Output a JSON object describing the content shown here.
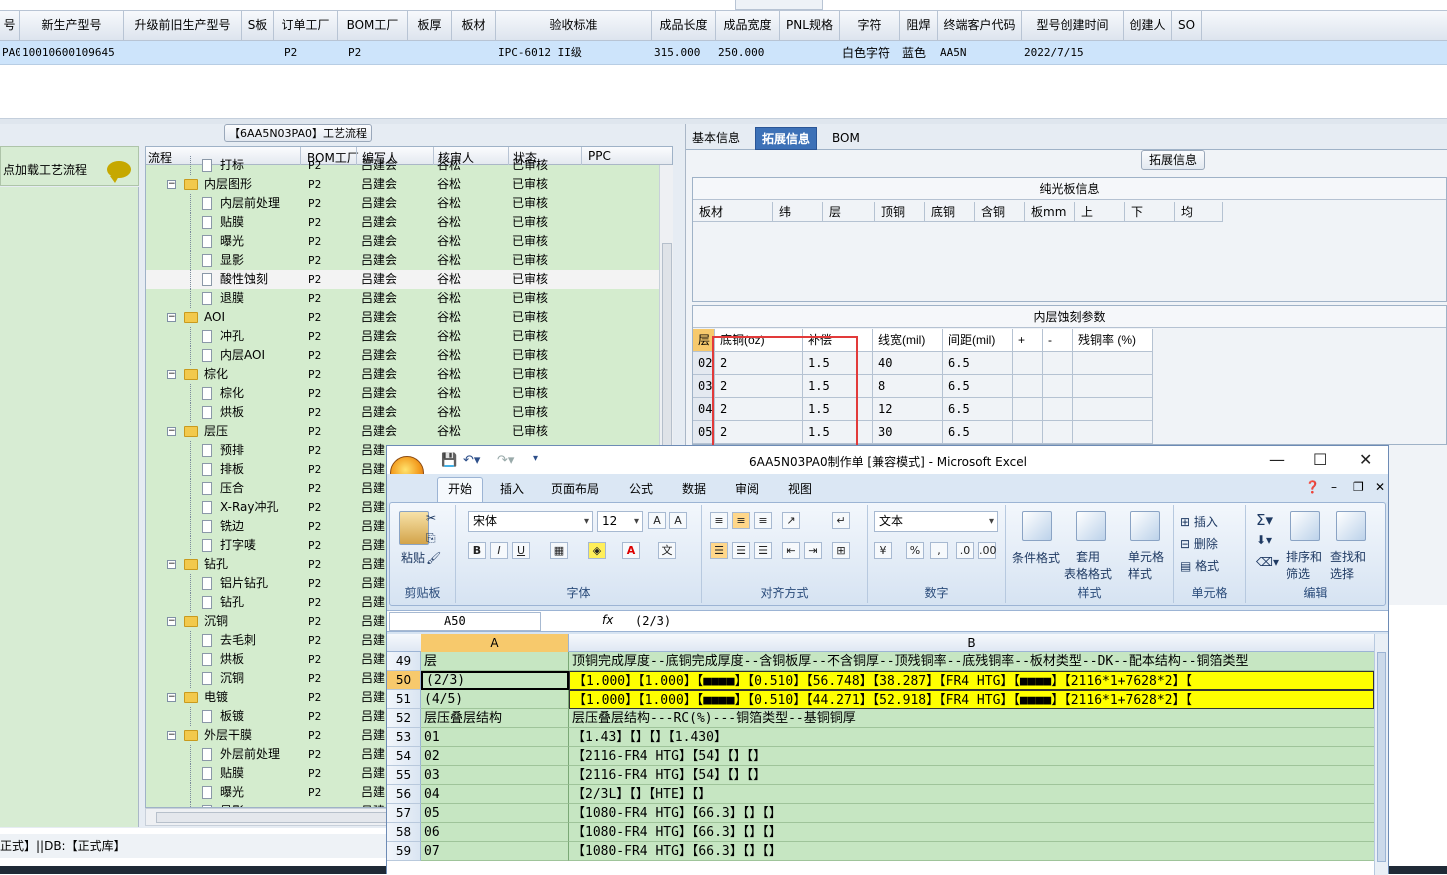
{
  "top_grid": {
    "headers": [
      "号",
      "新生产型号",
      "升级前旧生产型号",
      "S板",
      "订单工厂",
      "BOM工厂",
      "板厚",
      "板材",
      "验收标准",
      "成品长度",
      "成品宽度",
      "PNL规格",
      "字符",
      "阻焊",
      "终端客户代码",
      "型号创建时间",
      "创建人",
      "SO"
    ],
    "row": [
      "PA0",
      "10010600109645",
      "",
      "",
      "P2",
      "P2",
      "",
      "",
      "IPC-6012 II级",
      "315.000",
      "250.000",
      "",
      "白色字符",
      "蓝色",
      "AA5N",
      "2022/7/15",
      "",
      ""
    ]
  },
  "left": {
    "title": "【6AA5N03PA0】工艺流程",
    "load_label": "点加载工艺流程",
    "tree_headers": [
      "流程",
      "BOM工厂",
      "编写人",
      "核审人",
      "状态",
      "PPC"
    ],
    "rows": [
      {
        "indent": 1,
        "type": "doc",
        "name": "打标",
        "c1": "P2",
        "c2": "吕建会",
        "c3": "谷松",
        "c4": "已审核"
      },
      {
        "indent": 0,
        "type": "folder",
        "name": "内层图形",
        "c1": "P2",
        "c2": "吕建会",
        "c3": "谷松",
        "c4": "已审核"
      },
      {
        "indent": 1,
        "type": "doc",
        "name": "内层前处理",
        "c1": "P2",
        "c2": "吕建会",
        "c3": "谷松",
        "c4": "已审核"
      },
      {
        "indent": 1,
        "type": "doc",
        "name": "贴膜",
        "c1": "P2",
        "c2": "吕建会",
        "c3": "谷松",
        "c4": "已审核"
      },
      {
        "indent": 1,
        "type": "doc",
        "name": "曝光",
        "c1": "P2",
        "c2": "吕建会",
        "c3": "谷松",
        "c4": "已审核"
      },
      {
        "indent": 1,
        "type": "doc",
        "name": "显影",
        "c1": "P2",
        "c2": "吕建会",
        "c3": "谷松",
        "c4": "已审核"
      },
      {
        "indent": 1,
        "type": "doc",
        "name": "酸性蚀刻",
        "c1": "P2",
        "c2": "吕建会",
        "c3": "谷松",
        "c4": "已审核",
        "sel": true
      },
      {
        "indent": 1,
        "type": "doc",
        "name": "退膜",
        "c1": "P2",
        "c2": "吕建会",
        "c3": "谷松",
        "c4": "已审核"
      },
      {
        "indent": 0,
        "type": "folder",
        "name": "AOI",
        "c1": "P2",
        "c2": "吕建会",
        "c3": "谷松",
        "c4": "已审核"
      },
      {
        "indent": 1,
        "type": "doc",
        "name": "冲孔",
        "c1": "P2",
        "c2": "吕建会",
        "c3": "谷松",
        "c4": "已审核"
      },
      {
        "indent": 1,
        "type": "doc",
        "name": "内层AOI",
        "c1": "P2",
        "c2": "吕建会",
        "c3": "谷松",
        "c4": "已审核"
      },
      {
        "indent": 0,
        "type": "folder",
        "name": "棕化",
        "c1": "P2",
        "c2": "吕建会",
        "c3": "谷松",
        "c4": "已审核"
      },
      {
        "indent": 1,
        "type": "doc",
        "name": "棕化",
        "c1": "P2",
        "c2": "吕建会",
        "c3": "谷松",
        "c4": "已审核"
      },
      {
        "indent": 1,
        "type": "doc",
        "name": "烘板",
        "c1": "P2",
        "c2": "吕建会",
        "c3": "谷松",
        "c4": "已审核"
      },
      {
        "indent": 0,
        "type": "folder",
        "name": "层压",
        "c1": "P2",
        "c2": "吕建会",
        "c3": "谷松",
        "c4": "已审核"
      },
      {
        "indent": 1,
        "type": "doc",
        "name": "预排",
        "c1": "P2",
        "c2": "吕建",
        "c3": "",
        "c4": ""
      },
      {
        "indent": 1,
        "type": "doc",
        "name": "排板",
        "c1": "P2",
        "c2": "吕建",
        "c3": "",
        "c4": ""
      },
      {
        "indent": 1,
        "type": "doc",
        "name": "压合",
        "c1": "P2",
        "c2": "吕建",
        "c3": "",
        "c4": ""
      },
      {
        "indent": 1,
        "type": "doc",
        "name": "X-Ray冲孔",
        "c1": "P2",
        "c2": "吕建",
        "c3": "",
        "c4": ""
      },
      {
        "indent": 1,
        "type": "doc",
        "name": "铣边",
        "c1": "P2",
        "c2": "吕建",
        "c3": "",
        "c4": ""
      },
      {
        "indent": 1,
        "type": "doc",
        "name": "打字唛",
        "c1": "P2",
        "c2": "吕建",
        "c3": "",
        "c4": ""
      },
      {
        "indent": 0,
        "type": "folder",
        "name": "钻孔",
        "c1": "P2",
        "c2": "吕建",
        "c3": "",
        "c4": ""
      },
      {
        "indent": 1,
        "type": "doc",
        "name": "铝片钻孔",
        "c1": "P2",
        "c2": "吕建",
        "c3": "",
        "c4": ""
      },
      {
        "indent": 1,
        "type": "doc",
        "name": "钻孔",
        "c1": "P2",
        "c2": "吕建",
        "c3": "",
        "c4": ""
      },
      {
        "indent": 0,
        "type": "folder",
        "name": "沉铜",
        "c1": "P2",
        "c2": "吕建",
        "c3": "",
        "c4": ""
      },
      {
        "indent": 1,
        "type": "doc",
        "name": "去毛刺",
        "c1": "P2",
        "c2": "吕建",
        "c3": "",
        "c4": ""
      },
      {
        "indent": 1,
        "type": "doc",
        "name": "烘板",
        "c1": "P2",
        "c2": "吕建",
        "c3": "",
        "c4": ""
      },
      {
        "indent": 1,
        "type": "doc",
        "name": "沉铜",
        "c1": "P2",
        "c2": "吕建",
        "c3": "",
        "c4": ""
      },
      {
        "indent": 0,
        "type": "folder",
        "name": "电镀",
        "c1": "P2",
        "c2": "吕建",
        "c3": "",
        "c4": ""
      },
      {
        "indent": 1,
        "type": "doc",
        "name": "板镀",
        "c1": "P2",
        "c2": "吕建",
        "c3": "",
        "c4": ""
      },
      {
        "indent": 0,
        "type": "folder",
        "name": "外层干膜",
        "c1": "P2",
        "c2": "吕建",
        "c3": "",
        "c4": ""
      },
      {
        "indent": 1,
        "type": "doc",
        "name": "外层前处理",
        "c1": "P2",
        "c2": "吕建",
        "c3": "",
        "c4": ""
      },
      {
        "indent": 1,
        "type": "doc",
        "name": "贴膜",
        "c1": "P2",
        "c2": "吕建",
        "c3": "",
        "c4": ""
      },
      {
        "indent": 1,
        "type": "doc",
        "name": "曝光",
        "c1": "P2",
        "c2": "吕建",
        "c3": "",
        "c4": ""
      },
      {
        "indent": 1,
        "type": "doc",
        "name": "显影",
        "c1": "P2",
        "c2": "吕建",
        "c3": "",
        "c4": ""
      }
    ],
    "status_text": "正式】||DB:【正式库】"
  },
  "right": {
    "tabs": [
      "基本信息",
      "拓展信息",
      "BOM"
    ],
    "active_tab": 1,
    "ext_button": "拓展信息",
    "sect1_title": "纯光板信息",
    "sect1_cols": [
      "板材",
      "纬",
      "层",
      "顶铜",
      "底铜",
      "含铜",
      "板mm",
      "上",
      "下",
      "均"
    ],
    "sect2_title": "内层蚀刻参数",
    "sect2_cols": [
      "层",
      "底铜(oz)",
      "补偿",
      "线宽(mil)",
      "间距(mil)",
      "+",
      "-",
      "残铜率 (%)"
    ],
    "sect2_rows": [
      [
        "02",
        "2",
        "1.5",
        "40",
        "6.5",
        "",
        "",
        ""
      ],
      [
        "03",
        "2",
        "1.5",
        "8",
        "6.5",
        "",
        "",
        ""
      ],
      [
        "04",
        "2",
        "1.5",
        "12",
        "6.5",
        "",
        "",
        ""
      ],
      [
        "05",
        "2",
        "1.5",
        "30",
        "6.5",
        "",
        "",
        ""
      ]
    ]
  },
  "excel": {
    "title": "6AA5N03PA0制作单 [兼容模式] - Microsoft Excel",
    "tabs": [
      "开始",
      "插入",
      "页面布局",
      "公式",
      "数据",
      "审阅",
      "视图"
    ],
    "groups": {
      "clipboard": "剪贴板",
      "paste": "粘贴",
      "font": "字体",
      "font_name": "宋体",
      "font_size": "12",
      "align": "对齐方式",
      "number": "数字",
      "number_format": "文本",
      "styles": "样式",
      "cond_fmt": "条件格式",
      "table_fmt": "套用\n表格格式",
      "cell_style": "单元格\n样式",
      "cells": "单元格",
      "insert": "插入",
      "delete": "删除",
      "format": "格式",
      "editing": "编辑",
      "sort": "排序和\n筛选",
      "find": "查找和\n选择"
    },
    "name_box": "A50",
    "formula": "(2/3)",
    "col_a": "A",
    "col_b": "B",
    "rows": [
      {
        "n": "49",
        "a": "层",
        "b": "顶铜完成厚度--底铜完成厚度--含铜板厚--不含铜厚--顶残铜率--底残铜率--板材类型--DK--配本结构--铜箔类型",
        "y": false
      },
      {
        "n": "50",
        "a": "(2/3)",
        "b": "【1.000】【1.000】【■■■■】【0.510】【56.748】【38.287】【FR4 HTG】【■■■■】【2116*1+7628*2】【",
        "y": true,
        "sel": true
      },
      {
        "n": "51",
        "a": "(4/5)",
        "b": "【1.000】【1.000】【■■■■】【0.510】【44.271】【52.918】【FR4 HTG】【■■■■】【2116*1+7628*2】【",
        "y": true
      },
      {
        "n": "52",
        "a": "层压叠层结构",
        "b": "层压叠层结构---RC(%)---铜箔类型--基铜铜厚",
        "y": false
      },
      {
        "n": "53",
        "a": "01",
        "b": "【1.43】【】【】【1.430】",
        "y": false
      },
      {
        "n": "54",
        "a": "02",
        "b": "【2116-FR4 HTG】【54】【】【】",
        "y": false
      },
      {
        "n": "55",
        "a": "03",
        "b": "【2116-FR4 HTG】【54】【】【】",
        "y": false
      },
      {
        "n": "56",
        "a": "04",
        "b": "【2/3L】【】【HTE】【】",
        "y": false
      },
      {
        "n": "57",
        "a": "05",
        "b": "【1080-FR4 HTG】【66.3】【】【】",
        "y": false
      },
      {
        "n": "58",
        "a": "06",
        "b": "【1080-FR4 HTG】【66.3】【】【】",
        "y": false
      },
      {
        "n": "59",
        "a": "07",
        "b": "【1080-FR4 HTG】【66.3】【】【】",
        "y": false
      }
    ]
  }
}
